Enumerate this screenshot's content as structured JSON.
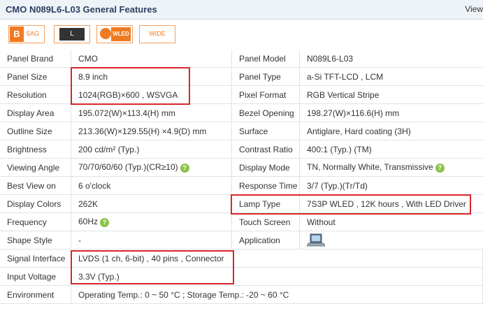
{
  "header": {
    "title": "CMO N089L6-L03 General Features",
    "view_label": "View"
  },
  "badges": {
    "b_letter": "B",
    "sag": "SAG",
    "l_letter": "L",
    "wled": "WLED",
    "wide": "WIDE"
  },
  "rows": [
    {
      "l1": "Panel Brand",
      "v1": "CMO",
      "l2": "Panel Model",
      "v2": "N089L6-L03"
    },
    {
      "l1": "Panel Size",
      "v1": "8.9 inch",
      "l2": "Panel Type",
      "v2": "a-Si TFT-LCD , LCM"
    },
    {
      "l1": "Resolution",
      "v1": "1024(RGB)×600 , WSVGA",
      "l2": "Pixel Format",
      "v2": "RGB Vertical Stripe"
    },
    {
      "l1": "Display Area",
      "v1": "195.072(W)×113.4(H) mm",
      "l2": "Bezel Opening",
      "v2": "198.27(W)×116.6(H) mm"
    },
    {
      "l1": "Outline Size",
      "v1": "213.36(W)×129.55(H) ×4.9(D) mm",
      "l2": "Surface",
      "v2": "Antiglare, Hard coating (3H)"
    },
    {
      "l1": "Brightness",
      "v1": "200 cd/m² (Typ.)",
      "l2": "Contrast Ratio",
      "v2": "400:1 (Typ.) (TM)"
    },
    {
      "l1": "Viewing Angle",
      "v1": "70/70/60/60 (Typ.)(CR≥10)",
      "l2": "Display Mode",
      "v2": "TN, Normally White, Transmissive"
    },
    {
      "l1": "Best View on",
      "v1": "6 o'clock",
      "l2": "Response Time",
      "v2": "3/7 (Typ.)(Tr/Td)"
    },
    {
      "l1": "Display Colors",
      "v1": "262K",
      "l2": "Lamp Type",
      "v2": "7S3P WLED , 12K hours , With LED Driver"
    },
    {
      "l1": "Frequency",
      "v1": "60Hz",
      "l2": "Touch Screen",
      "v2": "Without"
    },
    {
      "l1": "Shape Style",
      "v1": "-",
      "l2": "Application",
      "v2": ""
    },
    {
      "l1": "Signal Interface",
      "v1": "LVDS (1 ch, 6-bit) , 40 pins , Connector",
      "l2": "",
      "v2": ""
    },
    {
      "l1": "Input Voltage",
      "v1": "3.3V (Typ.)",
      "l2": "",
      "v2": ""
    },
    {
      "l1": "Environment",
      "v1": "Operating Temp.: 0 ~ 50 °C ; Storage Temp.: -20 ~ 60 °C",
      "l2": "",
      "v2": ""
    }
  ],
  "colors": {
    "highlight_box": "#d9262a",
    "header_bg": "#eef3f8",
    "accent": "#f07a20",
    "help_icon": "#8bc34a"
  },
  "help_glyph": "?"
}
